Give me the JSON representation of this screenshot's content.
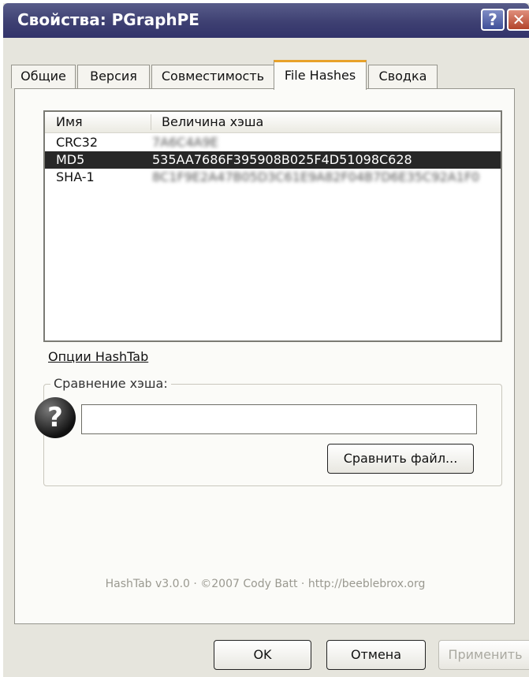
{
  "window": {
    "title": "Свойства: PGraphPE",
    "help_glyph": "?",
    "close_glyph": "✕"
  },
  "tabs": [
    {
      "label": "Общие"
    },
    {
      "label": "Версия"
    },
    {
      "label": "Совместимость"
    },
    {
      "label": "File Hashes",
      "active": true
    },
    {
      "label": "Сводка"
    }
  ],
  "hash_list": {
    "columns": {
      "name": "Имя",
      "hash": "Величина хэша"
    },
    "rows": [
      {
        "name": "CRC32",
        "hash": "7A6C4A9E",
        "selected": false,
        "obscured": true
      },
      {
        "name": "MD5",
        "hash": "535AA7686F395908B025F4D51098C628",
        "selected": true,
        "obscured": false
      },
      {
        "name": "SHA-1",
        "hash": "8C1F9E2A47B05D3C61E9A82F04B7D6E35C92A1F0",
        "selected": false,
        "obscured": true
      }
    ]
  },
  "options_link": "Опции HashTab",
  "compare": {
    "group_label": "Сравнение хэша:",
    "icon": "question-icon",
    "input_value": "",
    "compare_file_button": "Сравнить файл..."
  },
  "footer_text": "HashTab v3.0.0 · ©2007 Cody Batt · http://beeblebrox.org",
  "buttons": {
    "ok": "OK",
    "cancel": "Отмена",
    "apply": "Применить"
  },
  "colors": {
    "titlebar": "#3e4072",
    "selection": "#272727",
    "active_tab_accent": "#e8a22a"
  }
}
